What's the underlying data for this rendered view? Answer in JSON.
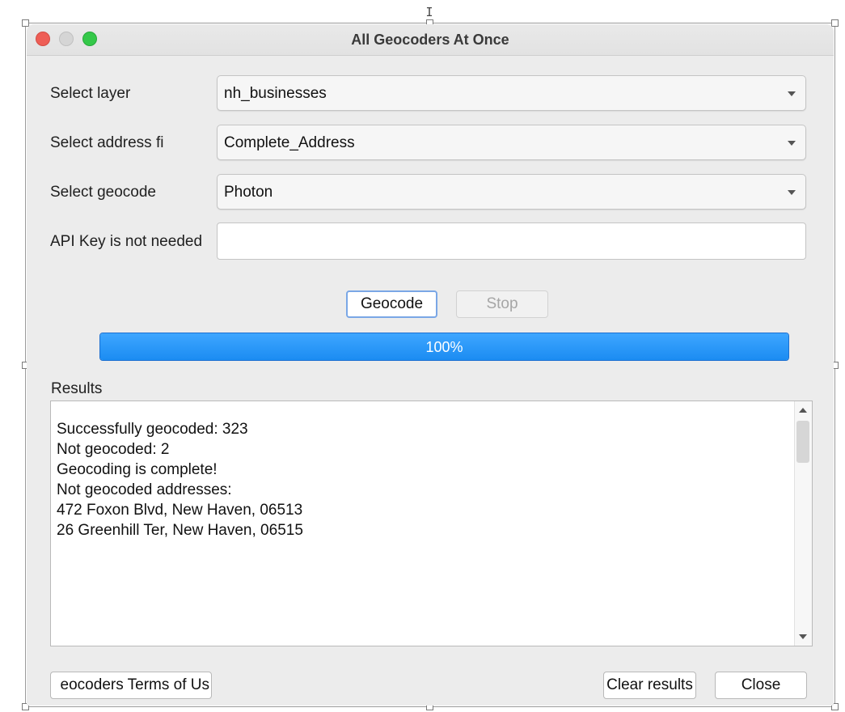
{
  "window": {
    "title": "All Geocoders At Once"
  },
  "form": {
    "layer_label": "Select layer",
    "layer_value": "nh_businesses",
    "address_label": "Select address fi",
    "address_value": "Complete_Address",
    "geocoder_label": "Select geocode",
    "geocoder_value": "Photon",
    "api_key_label": "API Key is not needed",
    "api_key_value": ""
  },
  "actions": {
    "geocode_label": "Geocode",
    "stop_label": "Stop"
  },
  "progress": {
    "value": 100,
    "text": "100%"
  },
  "results": {
    "label": "Results",
    "lines": [
      "Successfully geocoded: 323",
      "Not geocoded: 2",
      "Geocoding is complete!",
      "Not geocoded addresses:",
      "472 Foxon Blvd, New Haven, 06513",
      "26 Greenhill Ter, New Haven, 06515"
    ]
  },
  "footer": {
    "terms_label": "eocoders Terms of Us",
    "clear_label": "Clear results",
    "close_label": "Close"
  },
  "colors": {
    "accent": "#1b8cf2",
    "window_bg": "#ececec"
  }
}
